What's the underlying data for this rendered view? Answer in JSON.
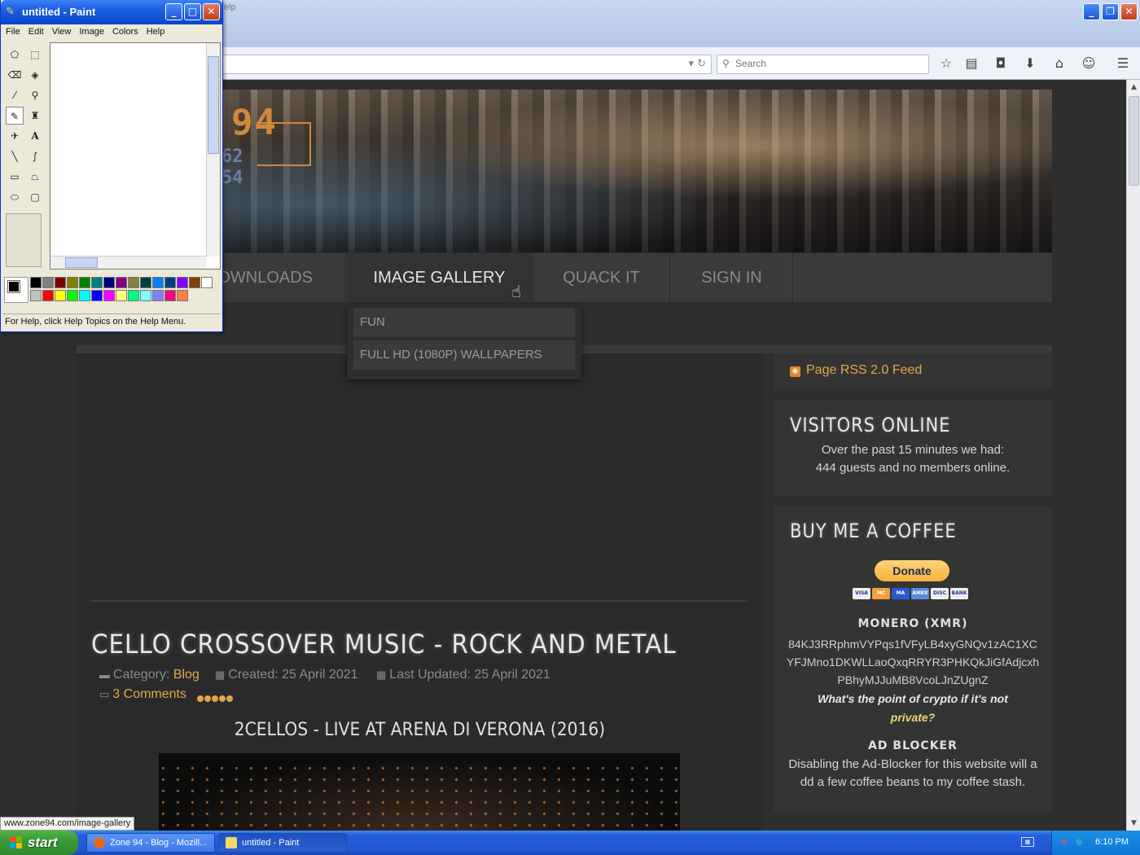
{
  "firefox": {
    "title_fragment": "elp",
    "search_placeholder": "Search",
    "toolbar_icons": [
      "star-icon",
      "reading-list-icon",
      "pocket-icon",
      "download-icon",
      "home-icon",
      "chat-icon",
      "menu-icon"
    ]
  },
  "site": {
    "logo_main": "94",
    "logo_sub1": "62",
    "logo_sub2": "54",
    "nav": [
      {
        "label": "DOWNLOADS",
        "shown": "OWNLOADS"
      },
      {
        "label": "IMAGE GALLERY"
      },
      {
        "label": "QUACK IT"
      },
      {
        "label": "SIGN IN"
      }
    ],
    "dropdown": [
      "FUN",
      "FULL HD (1080P) WALLPAPERS"
    ]
  },
  "article": {
    "title": "CELLO CROSSOVER MUSIC - ROCK AND METAL",
    "category_label": "Category:",
    "category": "Blog",
    "created": "Created: 25 April 2021",
    "updated": "Last Updated: 25 April 2021",
    "comments": "3 Comments",
    "rating_stars": 5,
    "video_title": "2CELLOS - LIVE AT ARENA DI VERONA (2016)"
  },
  "sidebar": {
    "rss": "Page RSS 2.0 Feed",
    "visitors_title": "VISITORS ONLINE",
    "visitors_line1": "Over the past 15 minutes we had:",
    "visitors_line2": "444 guests and no members online.",
    "coffee_title": "BUY ME A COFFEE",
    "donate_label": "Donate",
    "cards": [
      "VISA",
      "MC",
      "MA",
      "AMEX",
      "DISC",
      "BANK"
    ],
    "monero_title": "MONERO (XMR)",
    "monero_address": "84KJ3RRphmVYPqs1fVFyLB4xyGNQv1zAC1XCYFJMno1DKWLLaoQxqRRYR3PHKQkJiGfAdjcxhPBhyMJJuMB8VcoLJnZUgnZ",
    "quote_part1": "What's the point of crypto if it's not",
    "quote_part2": "private?",
    "adblock_title": "AD BLOCKER",
    "adblock_text": "Disabling the Ad-Blocker for this website will add a few coffee beans to my coffee stash."
  },
  "status_url": "www.zone94.com/image-gallery",
  "paint": {
    "title": "untitled - Paint",
    "menu": [
      "File",
      "Edit",
      "View",
      "Image",
      "Colors",
      "Help"
    ],
    "status": "For Help, click Help Topics on the Help Menu.",
    "palette": [
      "#000000",
      "#808080",
      "#800000",
      "#808000",
      "#008000",
      "#008080",
      "#000080",
      "#800080",
      "#808040",
      "#004040",
      "#0080ff",
      "#004080",
      "#8000ff",
      "#804000",
      "#ffffff",
      "#c0c0c0",
      "#ff0000",
      "#ffff00",
      "#00ff00",
      "#00ffff",
      "#0000ff",
      "#ff00ff",
      "#ffff80",
      "#00ff80",
      "#80ffff",
      "#8080ff",
      "#ff0080",
      "#ff8040"
    ]
  },
  "taskbar": {
    "start": "start",
    "tasks": [
      "Zone 94 - Blog - Mozill...",
      "untitled - Paint"
    ],
    "clock": "6:10 PM"
  }
}
